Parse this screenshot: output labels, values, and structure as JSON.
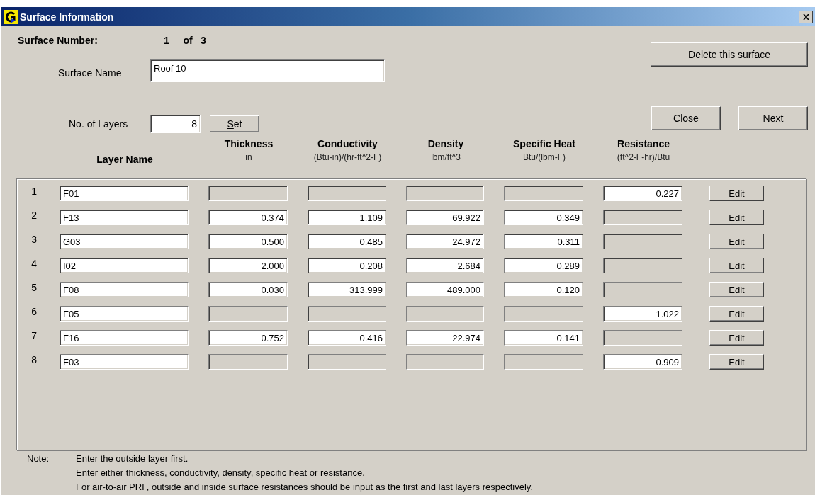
{
  "window": {
    "title": "Surface Information"
  },
  "surface_number": {
    "label": "Surface Number:",
    "value": "1",
    "of": "of",
    "total": "3"
  },
  "surface_name": {
    "label": "Surface Name",
    "value": "Roof 10"
  },
  "delete_button": {
    "label": "Delete this surface",
    "underline_first": true
  },
  "layer_count": {
    "label": "No. of Layers",
    "value": "8"
  },
  "set_button": {
    "label": "Set",
    "underline_first": true
  },
  "buttons": [
    {
      "label": "Close"
    },
    {
      "label": "Next"
    }
  ],
  "columns": [
    {
      "title": "Layer Name"
    },
    {
      "title": "Thickness",
      "unit": "in"
    },
    {
      "title": "Conductivity",
      "unit": "(Btu-in)/(hr-ft^2-F)"
    },
    {
      "title": "Density",
      "unit": "lbm/ft^3"
    },
    {
      "title": "Specific Heat",
      "unit": "Btu/(lbm-F)"
    },
    {
      "title": "Resistance",
      "unit": "(ft^2-F-hr)/Btu"
    }
  ],
  "layers": [
    {
      "number": "1",
      "name": "F01",
      "cells": [
        {
          "disabled": true
        },
        {
          "disabled": true
        },
        {
          "disabled": true
        },
        {
          "disabled": true
        },
        {
          "value": "0.227",
          "disabled": false
        }
      ],
      "edit": "Edit"
    },
    {
      "number": "2",
      "name": "F13",
      "cells": [
        {
          "value": "0.374",
          "disabled": false
        },
        {
          "value": "1.109",
          "disabled": false
        },
        {
          "value": "69.922",
          "disabled": false
        },
        {
          "value": "0.349",
          "disabled": false
        },
        {
          "disabled": true
        }
      ],
      "edit": "Edit"
    },
    {
      "number": "3",
      "name": "G03",
      "cells": [
        {
          "value": "0.500",
          "disabled": false
        },
        {
          "value": "0.485",
          "disabled": false
        },
        {
          "value": "24.972",
          "disabled": false
        },
        {
          "value": "0.311",
          "disabled": false
        },
        {
          "disabled": true
        }
      ],
      "edit": "Edit"
    },
    {
      "number": "4",
      "name": "I02",
      "cells": [
        {
          "value": "2.000",
          "disabled": false
        },
        {
          "value": "0.208",
          "disabled": false
        },
        {
          "value": "2.684",
          "disabled": false
        },
        {
          "value": "0.289",
          "disabled": false
        },
        {
          "disabled": true
        }
      ],
      "edit": "Edit"
    },
    {
      "number": "5",
      "name": "F08",
      "cells": [
        {
          "value": "0.030",
          "disabled": false
        },
        {
          "value": "313.999",
          "disabled": false
        },
        {
          "value": "489.000",
          "disabled": false
        },
        {
          "value": "0.120",
          "disabled": false
        },
        {
          "disabled": true
        }
      ],
      "edit": "Edit"
    },
    {
      "number": "6",
      "name": "F05",
      "cells": [
        {
          "disabled": true
        },
        {
          "disabled": true
        },
        {
          "disabled": true
        },
        {
          "disabled": true
        },
        {
          "value": "1.022",
          "disabled": false
        }
      ],
      "edit": "Edit"
    },
    {
      "number": "7",
      "name": "F16",
      "cells": [
        {
          "value": "0.752",
          "disabled": false
        },
        {
          "value": "0.416",
          "disabled": false
        },
        {
          "value": "22.974",
          "disabled": false
        },
        {
          "value": "0.141",
          "disabled": false
        },
        {
          "disabled": true
        }
      ],
      "edit": "Edit"
    },
    {
      "number": "8",
      "name": "F03",
      "cells": [
        {
          "disabled": true
        },
        {
          "disabled": true
        },
        {
          "disabled": true
        },
        {
          "disabled": true
        },
        {
          "value": "0.909",
          "disabled": false
        }
      ],
      "edit": "Edit"
    }
  ],
  "note": {
    "label": "Note:",
    "lines": [
      "Enter the outside layer first.",
      "Enter either thickness, conductivity, density, specific heat or resistance.",
      "For air-to-air PRF, outside and inside surface resistances should be input as the first and last layers respectively."
    ]
  }
}
